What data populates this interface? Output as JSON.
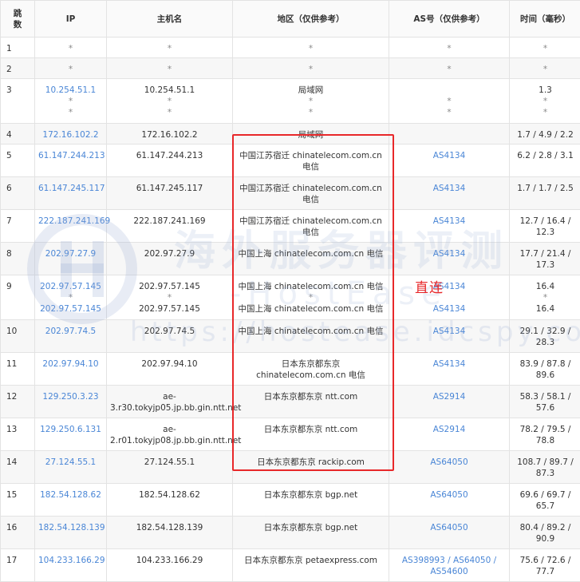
{
  "headers": {
    "hop": "跳数",
    "ip": "IP",
    "host": "主机名",
    "region": "地区（仅供参考）",
    "as": "AS号（仅供参考）",
    "time": "时间（毫秒）"
  },
  "rows": [
    {
      "hop": "1",
      "ip": [
        "*"
      ],
      "host": [
        "*"
      ],
      "region": [
        "*"
      ],
      "as": [
        "*"
      ],
      "time": [
        "*"
      ]
    },
    {
      "hop": "2",
      "ip": [
        "*"
      ],
      "host": [
        "*"
      ],
      "region": [
        "*"
      ],
      "as": [
        "*"
      ],
      "time": [
        "*"
      ]
    },
    {
      "hop": "3",
      "ip": [
        "10.254.51.1",
        "*",
        "*"
      ],
      "host": [
        "10.254.51.1",
        "*",
        "*"
      ],
      "region": [
        "局域网",
        "*",
        "*"
      ],
      "as": [
        "",
        "*",
        "*"
      ],
      "time": [
        "1.3",
        "*",
        "*"
      ]
    },
    {
      "hop": "4",
      "ip": [
        "172.16.102.2"
      ],
      "host": [
        "172.16.102.2"
      ],
      "region": [
        "局域网"
      ],
      "as": [
        ""
      ],
      "time": [
        "1.7 / 4.9 / 2.2"
      ]
    },
    {
      "hop": "5",
      "ip": [
        "61.147.244.213"
      ],
      "host": [
        "61.147.244.213"
      ],
      "region": [
        "中国江苏宿迁 chinatelecom.com.cn 电信"
      ],
      "as": [
        "AS4134"
      ],
      "time": [
        "6.2 / 2.8 / 3.1"
      ]
    },
    {
      "hop": "6",
      "ip": [
        "61.147.245.117"
      ],
      "host": [
        "61.147.245.117"
      ],
      "region": [
        "中国江苏宿迁 chinatelecom.com.cn 电信"
      ],
      "as": [
        "AS4134"
      ],
      "time": [
        "1.7 / 1.7 / 2.5"
      ]
    },
    {
      "hop": "7",
      "ip": [
        "222.187.241.169"
      ],
      "host": [
        "222.187.241.169"
      ],
      "region": [
        "中国江苏宿迁 chinatelecom.com.cn 电信"
      ],
      "as": [
        "AS4134"
      ],
      "time": [
        "12.7 / 16.4 / 12.3"
      ]
    },
    {
      "hop": "8",
      "ip": [
        "202.97.27.9"
      ],
      "host": [
        "202.97.27.9"
      ],
      "region": [
        "中国上海 chinatelecom.com.cn 电信"
      ],
      "as": [
        "AS4134"
      ],
      "time": [
        "17.7 / 21.4 / 17.3"
      ]
    },
    {
      "hop": "9",
      "ip": [
        "202.97.57.145",
        "*",
        "202.97.57.145"
      ],
      "host": [
        "202.97.57.145",
        "*",
        "202.97.57.145"
      ],
      "region": [
        "中国上海 chinatelecom.com.cn 电信",
        "*",
        "中国上海 chinatelecom.com.cn 电信"
      ],
      "as": [
        "AS4134",
        "",
        "AS4134"
      ],
      "time": [
        "16.4",
        "*",
        "16.4"
      ]
    },
    {
      "hop": "10",
      "ip": [
        "202.97.74.5"
      ],
      "host": [
        "202.97.74.5"
      ],
      "region": [
        "中国上海 chinatelecom.com.cn 电信"
      ],
      "as": [
        "AS4134"
      ],
      "time": [
        "29.1 / 32.9 / 28.3"
      ]
    },
    {
      "hop": "11",
      "ip": [
        "202.97.94.10"
      ],
      "host": [
        "202.97.94.10"
      ],
      "region": [
        "日本东京都东京 chinatelecom.com.cn 电信"
      ],
      "as": [
        "AS4134"
      ],
      "time": [
        "83.9 / 87.8 / 89.6"
      ]
    },
    {
      "hop": "12",
      "ip": [
        "129.250.3.23"
      ],
      "host": [
        "ae-3.r30.tokyjp05.jp.bb.gin.ntt.net"
      ],
      "region": [
        "日本东京都东京 ntt.com"
      ],
      "as": [
        "AS2914"
      ],
      "time": [
        "58.3 / 58.1 / 57.6"
      ]
    },
    {
      "hop": "13",
      "ip": [
        "129.250.6.131"
      ],
      "host": [
        "ae-2.r01.tokyjp08.jp.bb.gin.ntt.net"
      ],
      "region": [
        "日本东京都东京 ntt.com"
      ],
      "as": [
        "AS2914"
      ],
      "time": [
        "78.2 / 79.5 / 78.8"
      ]
    },
    {
      "hop": "14",
      "ip": [
        "27.124.55.1"
      ],
      "host": [
        "27.124.55.1"
      ],
      "region": [
        "日本东京都东京 rackip.com"
      ],
      "as": [
        "AS64050"
      ],
      "time": [
        "108.7 / 89.7 / 87.3"
      ]
    },
    {
      "hop": "15",
      "ip": [
        "182.54.128.62"
      ],
      "host": [
        "182.54.128.62"
      ],
      "region": [
        "日本东京都东京 bgp.net"
      ],
      "as": [
        "AS64050"
      ],
      "time": [
        "69.6 / 69.7 / 65.7"
      ]
    },
    {
      "hop": "16",
      "ip": [
        "182.54.128.139"
      ],
      "host": [
        "182.54.128.139"
      ],
      "region": [
        "日本东京都东京 bgp.net"
      ],
      "as": [
        "AS64050"
      ],
      "time": [
        "80.4 / 89.2 / 90.9"
      ]
    },
    {
      "hop": "17",
      "ip": [
        "104.233.166.29"
      ],
      "host": [
        "104.233.166.29"
      ],
      "region": [
        "日本东京都东京 petaexpress.com"
      ],
      "as": [
        "AS398993 / AS64050 / AS54600"
      ],
      "time": [
        "75.6 / 72.6 / 77.7"
      ]
    }
  ],
  "annotation": {
    "label": "直连",
    "color": "#e8282a"
  },
  "watermark": {
    "text": "海外服务器评测",
    "brand": "-HostEase",
    "url": "https://hostease.idcspy.com"
  },
  "colors": {
    "link": "#4a86d6",
    "border": "#e3e3e3",
    "highlight": "#e8282a",
    "stripe": "#f7f7f7"
  }
}
